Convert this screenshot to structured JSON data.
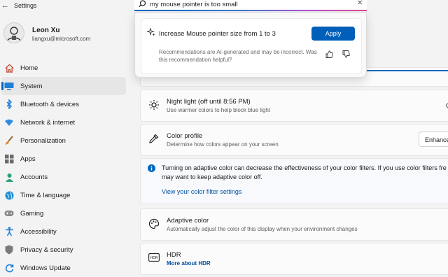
{
  "window": {
    "title": "Settings"
  },
  "user": {
    "name": "Leon Xu",
    "email": "liangxu@microsoft.com"
  },
  "sidebar": {
    "items": [
      {
        "label": "Home",
        "icon": "home-icon"
      },
      {
        "label": "System",
        "icon": "system-icon",
        "selected": true
      },
      {
        "label": "Bluetooth & devices",
        "icon": "bluetooth-icon"
      },
      {
        "label": "Network & internet",
        "icon": "network-icon"
      },
      {
        "label": "Personalization",
        "icon": "brush-icon"
      },
      {
        "label": "Apps",
        "icon": "apps-icon"
      },
      {
        "label": "Accounts",
        "icon": "accounts-icon"
      },
      {
        "label": "Time & language",
        "icon": "globe-icon"
      },
      {
        "label": "Gaming",
        "icon": "gamepad-icon"
      },
      {
        "label": "Accessibility",
        "icon": "accessibility-icon"
      },
      {
        "label": "Privacy & security",
        "icon": "shield-icon"
      },
      {
        "label": "Windows Update",
        "icon": "update-icon"
      }
    ]
  },
  "search": {
    "value": "my mouse pointer is too small",
    "recommendation": {
      "title": "Increase Mouse pointer size from 1 to 3",
      "apply_label": "Apply",
      "disclaimer": "Recommendations are AI-generated and may be incorrect. Was this recommendation helpful?"
    }
  },
  "main": {
    "night_light": {
      "title": "Night light (off until 8:56 PM)",
      "desc": "Use warmer colors to help block blue light",
      "toggle_text_partial": "O"
    },
    "color_profile": {
      "title": "Color profile",
      "desc": "Determine how colors appear on your screen",
      "dropdown_value": "Enhance"
    },
    "info": {
      "line1": "Turning on adaptive color can decrease the effectiveness of your color filters. If you use color filters fre",
      "line2": "may want to keep adaptive color off.",
      "link": "View your color filter settings"
    },
    "adaptive_color": {
      "title": "Adaptive color",
      "desc": "Automatically adjust the color of this display when your environment changes"
    },
    "hdr": {
      "title": "HDR",
      "link": "More about HDR"
    }
  },
  "colors": {
    "accent": "#0067c0",
    "apply_button": "#005fb8",
    "link": "#0050a0"
  }
}
